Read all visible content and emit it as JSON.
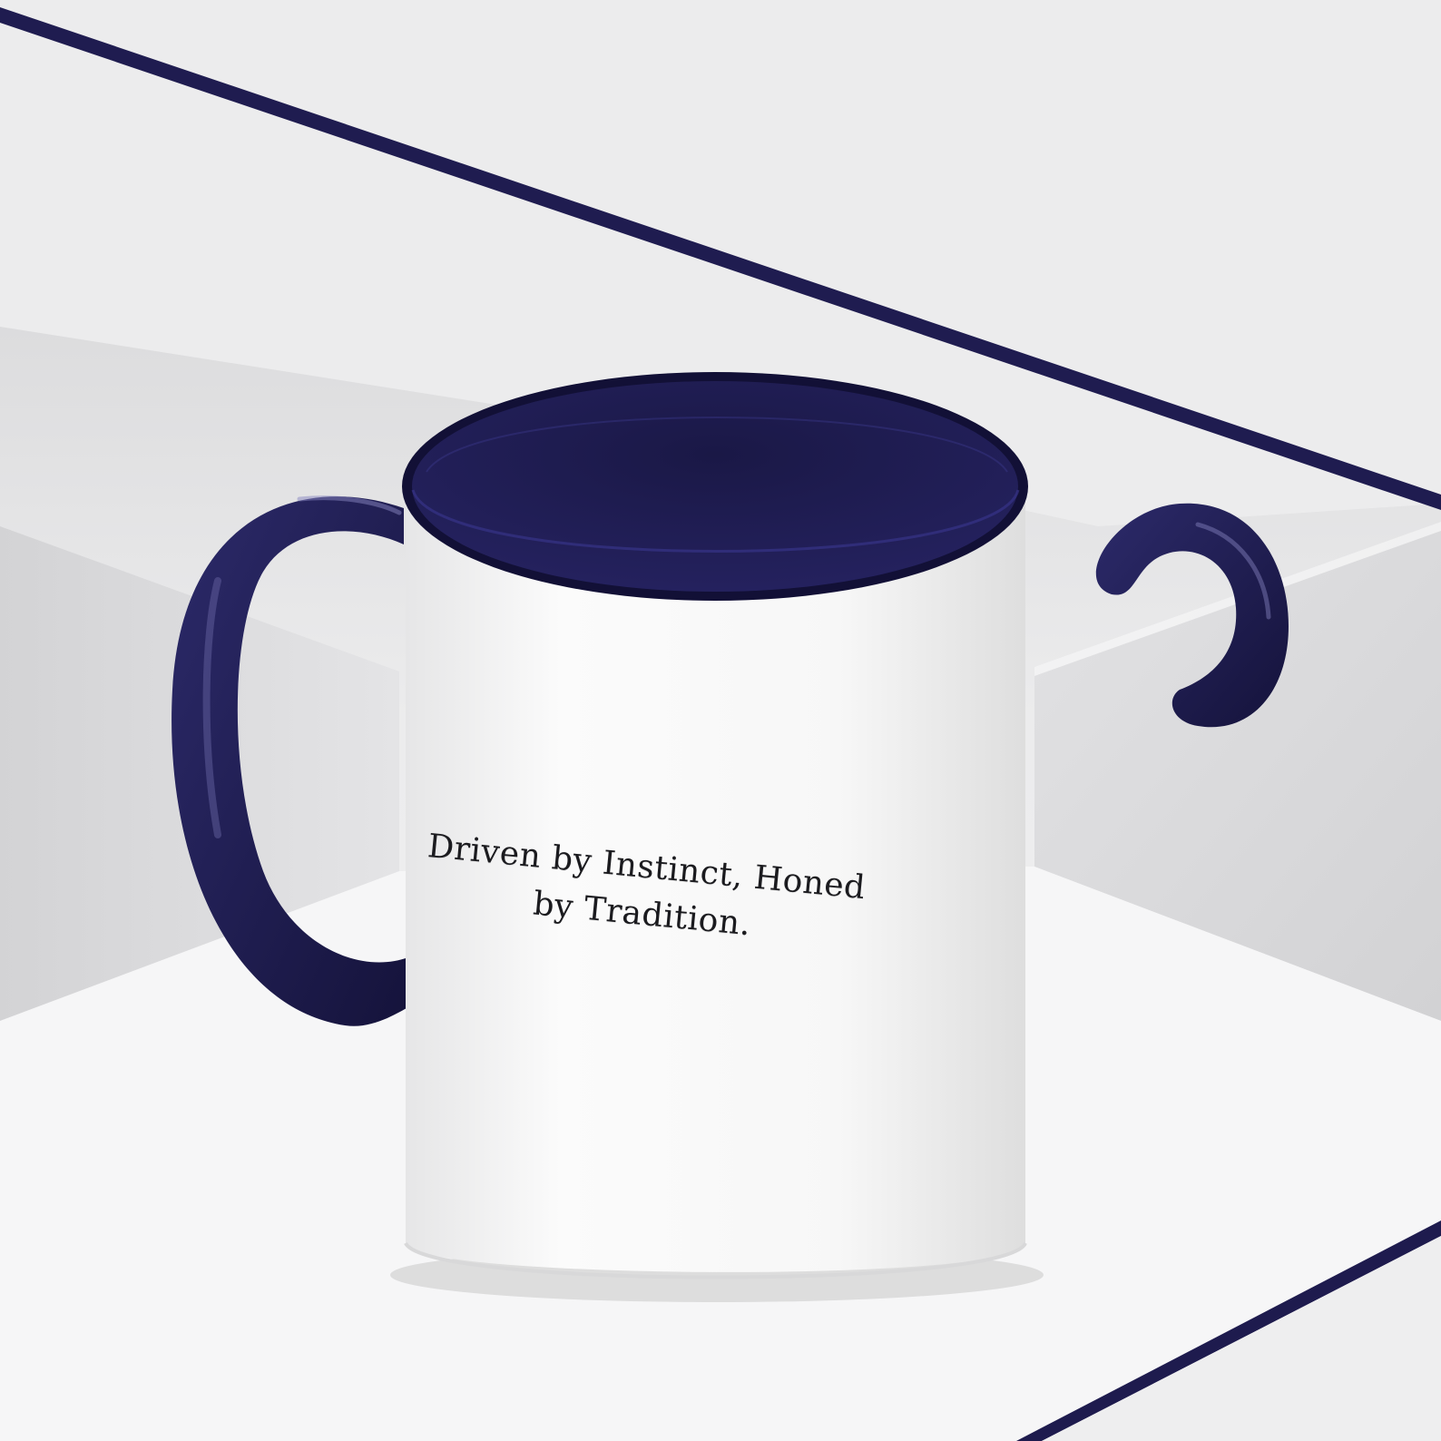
{
  "scene": {
    "subject": "mug",
    "colors": {
      "background": "#e9e9ea",
      "mug_body": "#f6f6f6",
      "accent_navy": "#1e1b4e",
      "rim_edge": "#0f0d33",
      "pedestal_top": "#f7f7f7"
    }
  },
  "mug_print": {
    "line1": "Driven by Instinct, Honed",
    "line2": "by Tradition."
  }
}
